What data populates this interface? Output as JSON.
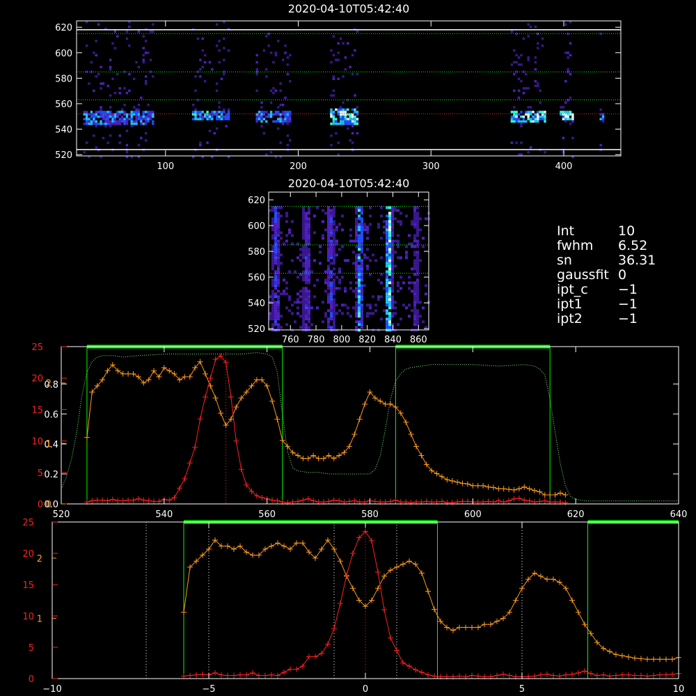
{
  "chart_data": [
    {
      "type": "heatmap",
      "title": "2020-04-10T05:42:40",
      "x_ticks": [
        100,
        200,
        300,
        400
      ],
      "xlim": [
        33,
        443
      ],
      "y_ticks": [
        520,
        540,
        560,
        580,
        600,
        620
      ],
      "ylim": [
        519,
        625
      ],
      "solid_hlines": [
        524,
        618
      ],
      "green_dotted_hlines": [
        563,
        585,
        615
      ],
      "red_dotted_hlines": [
        552
      ],
      "bands": [
        {
          "x0": 38,
          "x1": 90,
          "rows": [
            545,
            556
          ],
          "brightness": 0.65
        },
        {
          "x0": 120,
          "x1": 147,
          "rows": [
            547,
            555
          ],
          "brightness": 0.7
        },
        {
          "x0": 168,
          "x1": 193,
          "rows": [
            546,
            555
          ],
          "brightness": 0.6
        },
        {
          "x0": 224,
          "x1": 244,
          "rows": [
            545,
            557
          ],
          "brightness": 0.9
        },
        {
          "x0": 360,
          "x1": 385,
          "rows": [
            546,
            556
          ],
          "brightness": 0.9
        },
        {
          "x0": 397,
          "x1": 406,
          "rows": [
            547,
            556
          ],
          "brightness": 0.95
        },
        {
          "x0": 427,
          "x1": 430,
          "rows": [
            548,
            554
          ],
          "brightness": 0.6
        }
      ]
    },
    {
      "type": "heatmap",
      "title": "2020-04-10T05:42:40",
      "x_ticks": [
        760,
        780,
        800,
        820,
        840,
        860
      ],
      "xlim": [
        743,
        868
      ],
      "y_ticks": [
        520,
        540,
        560,
        580,
        600,
        620
      ],
      "ylim": [
        519,
        626
      ],
      "green_dotted_hlines": [
        563,
        585,
        615
      ],
      "columns": [
        {
          "x": 748,
          "brightness": 0.55
        },
        {
          "x": 772,
          "brightness": 0.45
        },
        {
          "x": 790,
          "brightness": 0.5
        },
        {
          "x": 813,
          "brightness": 0.8
        },
        {
          "x": 836,
          "brightness": 0.95
        },
        {
          "x": 857,
          "brightness": 0.35
        }
      ]
    },
    {
      "type": "line",
      "xlim": [
        520,
        640
      ],
      "x_ticks": [
        520,
        540,
        560,
        580,
        600,
        620,
        640
      ],
      "left_axis_white": {
        "ylim": [
          0,
          1.05
        ],
        "ticks": [
          0.0,
          0.2,
          0.4,
          0.6,
          0.8
        ]
      },
      "left_axis_red": {
        "ylim": [
          0,
          25
        ],
        "ticks": [
          0,
          5,
          10,
          15,
          20,
          25
        ]
      },
      "left_axis_orange": {
        "ylim": [
          0,
          2.6
        ],
        "ticks": [
          0,
          1,
          2
        ]
      },
      "green_windows": [
        [
          525,
          563
        ],
        [
          585,
          615
        ]
      ],
      "red_center": 552,
      "series": [
        {
          "color": "#ff9a1f",
          "axis": "orange",
          "marker": "+",
          "x": [
            525,
            526,
            527,
            528,
            529,
            530,
            531,
            532,
            533,
            534,
            535,
            536,
            537,
            538,
            539,
            540,
            541,
            542,
            543,
            544,
            545,
            546,
            547,
            548,
            549,
            550,
            551,
            552,
            553,
            554,
            555,
            556,
            557,
            558,
            559,
            560,
            561,
            562,
            563,
            564,
            565,
            566,
            567,
            568,
            569,
            570,
            571,
            572,
            573,
            574,
            575,
            576,
            577,
            578,
            579,
            580,
            581,
            582,
            583,
            584,
            585,
            586,
            587,
            588,
            589,
            590,
            591,
            592,
            593,
            594,
            595,
            596,
            597,
            598,
            599,
            600,
            601,
            602,
            603,
            604,
            605,
            606,
            607,
            608,
            609,
            610,
            611,
            612,
            613,
            614,
            615,
            616,
            617,
            618
          ],
          "y": [
            1.1,
            1.85,
            1.95,
            2.05,
            2.2,
            2.3,
            2.2,
            2.15,
            2.15,
            2.15,
            2.1,
            2.0,
            2.05,
            2.2,
            2.1,
            2.25,
            2.2,
            2.15,
            2.05,
            2.1,
            2.1,
            2.25,
            2.35,
            2.15,
            1.95,
            1.75,
            1.5,
            1.3,
            1.4,
            1.6,
            1.75,
            1.85,
            1.95,
            2.05,
            2.05,
            1.95,
            1.7,
            1.4,
            1.05,
            0.95,
            0.85,
            0.8,
            0.75,
            0.75,
            0.8,
            0.75,
            0.75,
            0.8,
            0.75,
            0.8,
            0.85,
            0.95,
            1.15,
            1.4,
            1.65,
            1.85,
            1.75,
            1.7,
            1.65,
            1.65,
            1.6,
            1.5,
            1.35,
            1.15,
            0.95,
            0.8,
            0.65,
            0.55,
            0.5,
            0.45,
            0.4,
            0.38,
            0.36,
            0.34,
            0.33,
            0.3,
            0.3,
            0.3,
            0.28,
            0.27,
            0.25,
            0.25,
            0.24,
            0.23,
            0.25,
            0.28,
            0.25,
            0.22,
            0.2,
            0.15,
            0.15,
            0.15,
            0.18,
            0.15
          ]
        },
        {
          "color": "#ff2020",
          "axis": "red",
          "marker": "+",
          "x": [
            525,
            526,
            527,
            528,
            529,
            530,
            531,
            532,
            533,
            534,
            535,
            536,
            537,
            538,
            539,
            540,
            541,
            542,
            543,
            544,
            545,
            546,
            547,
            548,
            549,
            550,
            551,
            552,
            553,
            554,
            555,
            556,
            557,
            558,
            559,
            560,
            561,
            562,
            563,
            564,
            565,
            566,
            567,
            568,
            569,
            570,
            571,
            572,
            573,
            574,
            575,
            576,
            577,
            578,
            579,
            580,
            581,
            582,
            583,
            584,
            585,
            586,
            587,
            588,
            589,
            590,
            591,
            592,
            593,
            594,
            595,
            596,
            597,
            598,
            599,
            600,
            601,
            602,
            603,
            604,
            605,
            606,
            607,
            608,
            609,
            610,
            611,
            612,
            613,
            614,
            615,
            616,
            617,
            618
          ],
          "y": [
            0.3,
            0.5,
            0.6,
            0.6,
            0.5,
            0.7,
            0.5,
            0.5,
            0.6,
            0.6,
            0.8,
            0.6,
            0.5,
            0.4,
            0.4,
            0.7,
            0.6,
            1.0,
            2.5,
            4.0,
            6.5,
            9.0,
            13.5,
            17.0,
            20.0,
            23.0,
            23.5,
            22.5,
            17.0,
            10.0,
            5.5,
            3.0,
            2.0,
            1.3,
            1.0,
            0.8,
            0.6,
            0.5,
            0.3,
            0.2,
            0.3,
            0.4,
            0.6,
            0.8,
            0.5,
            0.3,
            0.3,
            0.4,
            0.6,
            0.5,
            0.3,
            0.4,
            0.5,
            0.3,
            0.3,
            0.5,
            0.4,
            0.3,
            0.3,
            0.4,
            0.6,
            0.3,
            0.3,
            0.2,
            0.3,
            0.3,
            0.4,
            0.3,
            0.3,
            0.4,
            0.2,
            0.2,
            0.3,
            0.4,
            0.4,
            0.3,
            0.3,
            0.3,
            0.4,
            0.3,
            0.5,
            0.3,
            0.5,
            0.8,
            0.9,
            0.6,
            0.5,
            0.3,
            0.4,
            0.5,
            0.3,
            0.3,
            0.3,
            0.2
          ]
        },
        {
          "color": "#7dff7d",
          "axis": "white",
          "style": "dotted",
          "x": [
            520,
            521,
            522,
            523,
            524,
            525,
            526,
            527,
            528,
            530,
            532,
            535,
            540,
            545,
            550,
            555,
            558,
            560,
            561,
            562,
            563,
            564,
            565,
            566,
            568,
            570,
            572,
            575,
            578,
            580,
            581,
            582,
            583,
            584,
            585,
            586,
            587,
            588,
            590,
            592,
            595,
            600,
            605,
            610,
            612,
            613,
            614,
            615,
            616,
            617,
            618,
            619,
            620,
            622,
            625,
            630,
            635,
            640
          ],
          "y": [
            0.1,
            0.18,
            0.3,
            0.48,
            0.72,
            0.88,
            0.95,
            0.98,
            0.99,
            0.99,
            0.98,
            0.99,
            1.0,
            1.0,
            1.0,
            1.0,
            1.01,
            1.0,
            0.98,
            0.88,
            0.6,
            0.35,
            0.24,
            0.22,
            0.21,
            0.21,
            0.2,
            0.2,
            0.2,
            0.2,
            0.23,
            0.32,
            0.5,
            0.7,
            0.82,
            0.87,
            0.9,
            0.91,
            0.92,
            0.93,
            0.93,
            0.93,
            0.92,
            0.93,
            0.92,
            0.9,
            0.86,
            0.7,
            0.48,
            0.27,
            0.12,
            0.05,
            0.03,
            0.02,
            0.02,
            0.02,
            0.02,
            0.02
          ]
        }
      ]
    },
    {
      "type": "line",
      "xlim": [
        -10,
        10
      ],
      "x_ticks": [
        -10,
        -5,
        0,
        5,
        10
      ],
      "left_axis_red": {
        "ylim": [
          0,
          25
        ],
        "ticks": [
          0,
          5,
          10,
          15,
          20,
          25
        ]
      },
      "left_axis_orange": {
        "ylim": [
          0,
          2.6
        ],
        "ticks": [
          1,
          2
        ]
      },
      "green_windows": [
        [
          -5.8,
          2.3
        ],
        [
          7.1,
          10
        ]
      ],
      "white_dotted_vlines": [
        -7,
        -5,
        -1,
        1,
        5
      ],
      "red_center": 0,
      "series": [
        {
          "color": "#ff9a1f",
          "axis": "orange",
          "marker": "+",
          "x": [
            -5.8,
            -5.6,
            -5.4,
            -5.2,
            -5.0,
            -4.8,
            -4.6,
            -4.4,
            -4.2,
            -4.0,
            -3.8,
            -3.6,
            -3.4,
            -3.2,
            -3.0,
            -2.8,
            -2.6,
            -2.4,
            -2.2,
            -2.0,
            -1.8,
            -1.6,
            -1.4,
            -1.2,
            -1.0,
            -0.8,
            -0.6,
            -0.4,
            -0.2,
            0.0,
            0.2,
            0.4,
            0.6,
            0.8,
            1.0,
            1.2,
            1.4,
            1.6,
            1.8,
            2.0,
            2.2,
            2.4,
            2.6,
            2.8,
            3.0,
            3.2,
            3.4,
            3.6,
            3.8,
            4.0,
            4.2,
            4.4,
            4.6,
            4.8,
            5.0,
            5.2,
            5.4,
            5.6,
            5.8,
            6.0,
            6.2,
            6.4,
            6.6,
            6.8,
            7.0,
            7.2,
            7.4,
            7.6,
            7.8,
            8.0,
            8.2,
            8.4,
            8.6,
            8.8,
            9.0,
            9.2,
            9.4,
            9.6,
            9.8,
            10.0
          ],
          "y": [
            1.1,
            1.85,
            1.95,
            2.05,
            2.15,
            2.3,
            2.2,
            2.2,
            2.15,
            2.2,
            2.1,
            2.05,
            2.05,
            2.15,
            2.2,
            2.25,
            2.2,
            2.15,
            2.25,
            2.25,
            2.1,
            2.0,
            2.15,
            2.3,
            2.15,
            1.95,
            1.7,
            1.5,
            1.3,
            1.2,
            1.3,
            1.5,
            1.7,
            1.8,
            1.85,
            1.9,
            1.95,
            1.9,
            1.75,
            1.45,
            1.15,
            0.95,
            0.85,
            0.8,
            0.85,
            0.85,
            0.85,
            0.85,
            0.9,
            0.9,
            0.95,
            1.0,
            1.1,
            1.3,
            1.5,
            1.65,
            1.75,
            1.7,
            1.65,
            1.65,
            1.6,
            1.5,
            1.3,
            1.1,
            0.9,
            0.75,
            0.6,
            0.5,
            0.45,
            0.4,
            0.38,
            0.36,
            0.34,
            0.33,
            0.32,
            0.32,
            0.32,
            0.32,
            0.32,
            0.35
          ]
        },
        {
          "color": "#ff2020",
          "axis": "red",
          "marker": "+",
          "x": [
            -5.8,
            -5.6,
            -5.4,
            -5.2,
            -5.0,
            -4.8,
            -4.6,
            -4.4,
            -4.2,
            -4.0,
            -3.8,
            -3.6,
            -3.4,
            -3.2,
            -3.0,
            -2.8,
            -2.6,
            -2.4,
            -2.2,
            -2.0,
            -1.8,
            -1.6,
            -1.4,
            -1.2,
            -1.0,
            -0.8,
            -0.6,
            -0.4,
            -0.2,
            0.0,
            0.2,
            0.4,
            0.6,
            0.8,
            1.0,
            1.2,
            1.4,
            1.6,
            1.8,
            2.0,
            2.2,
            2.4,
            2.6,
            2.8,
            3.0,
            3.2,
            3.4,
            3.6,
            3.8,
            4.0,
            4.2,
            4.4,
            4.6,
            4.8,
            5.0,
            5.2,
            5.4,
            5.6,
            5.8,
            6.0,
            6.2,
            6.4,
            6.6,
            6.8,
            7.0,
            7.2,
            7.4,
            7.6,
            7.8,
            8.0,
            8.2,
            8.4,
            8.6,
            8.8,
            9.0,
            9.2,
            9.4,
            9.6,
            9.8,
            10.0
          ],
          "y": [
            0.4,
            0.5,
            0.6,
            0.7,
            0.6,
            0.9,
            0.6,
            0.5,
            0.5,
            0.6,
            0.6,
            0.9,
            0.5,
            0.5,
            0.6,
            0.5,
            1.0,
            1.5,
            1.5,
            2.0,
            3.5,
            3.5,
            4.0,
            5.5,
            8.0,
            12.0,
            16.5,
            20.0,
            22.5,
            23.5,
            22.0,
            17.0,
            11.0,
            6.5,
            4.5,
            2.5,
            2.0,
            1.4,
            1.0,
            0.6,
            0.4,
            0.3,
            0.3,
            0.3,
            0.4,
            0.3,
            0.5,
            0.4,
            0.3,
            0.3,
            0.5,
            0.7,
            0.5,
            0.3,
            0.3,
            0.3,
            0.4,
            0.6,
            0.7,
            0.5,
            0.4,
            0.6,
            0.7,
            0.9,
            1.2,
            0.8,
            0.5,
            0.6,
            0.4,
            0.5,
            0.6,
            0.6,
            0.5,
            0.5,
            0.4,
            0.5,
            0.6,
            0.6,
            0.7,
            0.8
          ]
        }
      ]
    }
  ],
  "info": {
    "rows": [
      {
        "key": "Int",
        "value": "10"
      },
      {
        "key": "fwhm",
        "value": "6.52"
      },
      {
        "key": "sn",
        "value": "36.31"
      },
      {
        "key": "gaussfit",
        "value": "0"
      },
      {
        "key": "ipt_c",
        "value": "−1"
      },
      {
        "key": "ipt1",
        "value": "−1"
      },
      {
        "key": "ipt2",
        "value": "−1"
      }
    ]
  },
  "colors": {
    "green": "#00ff00",
    "orange": "#ff9a1f",
    "red": "#ff2020",
    "axis": "#ffffff",
    "background": "#000000"
  }
}
